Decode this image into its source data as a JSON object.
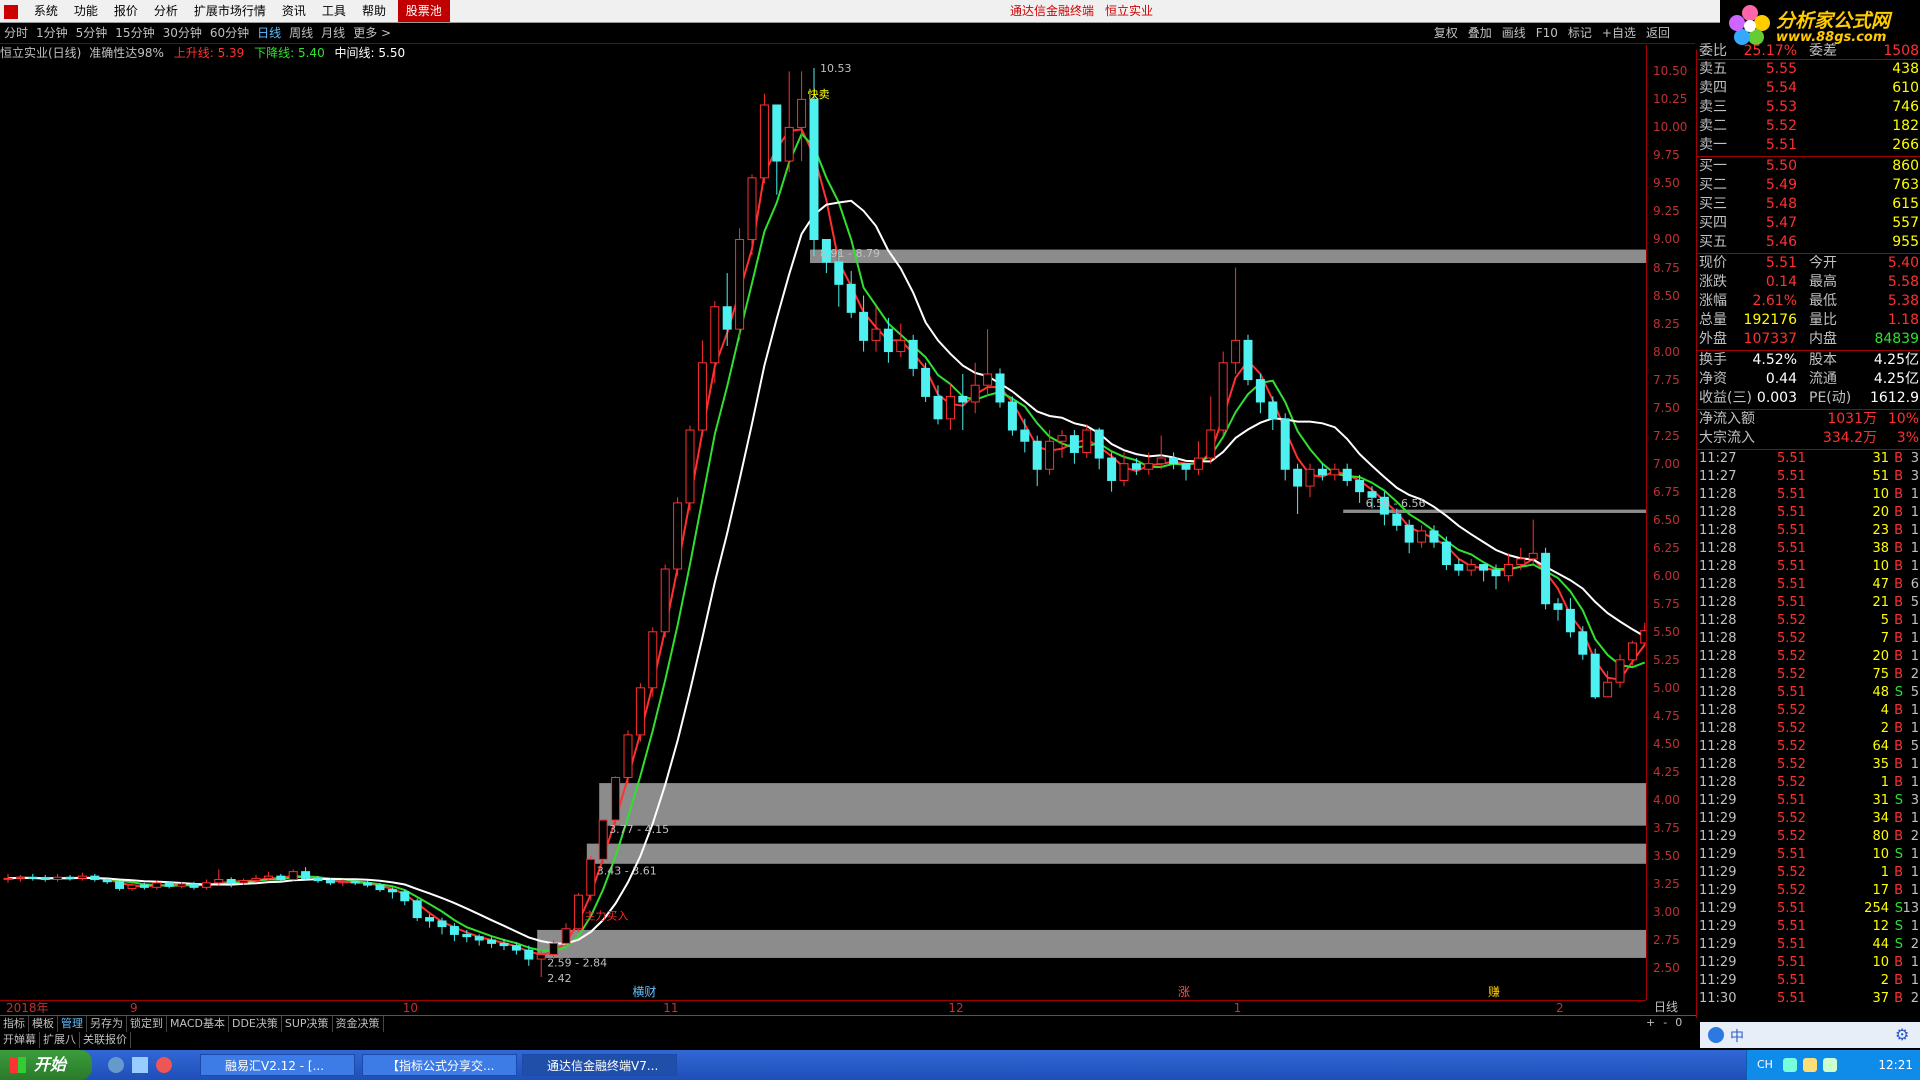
{
  "menubar": {
    "items": [
      "系统",
      "功能",
      "报价",
      "分析",
      "扩展市场行情",
      "资讯",
      "工具",
      "帮助"
    ],
    "hot_item": "股票池",
    "title": "通达信金融终端",
    "stock": "恒立实业"
  },
  "logo": {
    "line1": "分析家公式网",
    "line2": "www.88gs.com"
  },
  "periods": [
    "分时",
    "1分钟",
    "5分钟",
    "15分钟",
    "30分钟",
    "60分钟",
    "日线",
    "周线",
    "月线",
    "更多 >"
  ],
  "active_period": "日线",
  "right_tools": [
    "复权",
    "叠加",
    "画线",
    "F10",
    "标记",
    "+自选",
    "返回"
  ],
  "indicator": {
    "name": "恒立实业(日线)",
    "accuracy": "准确性达98%",
    "up_label": "上升线: 5.39",
    "down_label": "下降线: 5.40",
    "mid_label": "中间线: 5.50",
    "colors": {
      "up": "#ff3030",
      "down": "#30e030",
      "mid": "#ffffff"
    }
  },
  "chart_data": {
    "type": "candlestick",
    "y_ticks": [
      "10.50",
      "10.25",
      "10.00",
      "9.75",
      "9.50",
      "9.25",
      "9.00",
      "8.75",
      "8.50",
      "8.25",
      "8.00",
      "7.75",
      "7.50",
      "7.25",
      "7.00",
      "6.75",
      "6.50",
      "6.25",
      "6.00",
      "5.75",
      "5.50",
      "5.25",
      "5.00",
      "4.75",
      "4.50",
      "4.25",
      "4.00",
      "3.75",
      "3.50",
      "3.25",
      "3.00",
      "2.75",
      "2.50"
    ],
    "ylim": [
      2.42,
      10.53
    ],
    "x_labels": [
      {
        "text": "2018年",
        "idx": 0
      },
      {
        "text": "9",
        "idx": 10
      },
      {
        "text": "10",
        "idx": 32
      },
      {
        "text": "11",
        "idx": 53
      },
      {
        "text": "12",
        "idx": 76
      },
      {
        "text": "1",
        "idx": 99
      },
      {
        "text": "2",
        "idx": 125
      }
    ],
    "annotations": [
      {
        "text": "10.53",
        "idx": 65,
        "price": 10.53
      },
      {
        "text": "快卖",
        "idx": 64,
        "price": 10.3
      },
      {
        "text": "8.91 - 8.79",
        "idx": 65,
        "price": 8.88
      },
      {
        "text": "6.59 - 6.56",
        "idx": 109,
        "price": 6.65
      },
      {
        "text": "3.77 - 4.15",
        "idx": 48,
        "price": 3.74
      },
      {
        "text": "3.43 - 3.61",
        "idx": 47,
        "price": 3.37
      },
      {
        "text": "主力买入",
        "idx": 46,
        "price": 2.97
      },
      {
        "text": "2.59 - 2.84",
        "idx": 43,
        "price": 2.55
      },
      {
        "text": "2.42",
        "idx": 43,
        "price": 2.41
      }
    ],
    "zones": [
      {
        "low": 8.79,
        "high": 8.91,
        "from_idx": 65
      },
      {
        "low": 6.56,
        "high": 6.59,
        "from_idx": 108
      },
      {
        "low": 3.77,
        "high": 4.15,
        "from_idx": 48
      },
      {
        "low": 3.43,
        "high": 3.61,
        "from_idx": 47
      },
      {
        "low": 2.59,
        "high": 2.84,
        "from_idx": 43
      }
    ],
    "bottom_marks": [
      {
        "text": "横财",
        "idx": 51,
        "color": "#5fbfff"
      },
      {
        "text": "涨",
        "idx": 95,
        "color": "#ff5050"
      },
      {
        "text": "赚",
        "idx": 120,
        "color": "#ffcc00"
      }
    ],
    "candles": [
      [
        3.3,
        3.3,
        3.34,
        3.26
      ],
      [
        3.3,
        3.31,
        3.33,
        3.27
      ],
      [
        3.31,
        3.3,
        3.34,
        3.28
      ],
      [
        3.3,
        3.29,
        3.33,
        3.27
      ],
      [
        3.29,
        3.31,
        3.34,
        3.27
      ],
      [
        3.31,
        3.3,
        3.33,
        3.28
      ],
      [
        3.3,
        3.32,
        3.35,
        3.28
      ],
      [
        3.32,
        3.29,
        3.34,
        3.27
      ],
      [
        3.29,
        3.27,
        3.31,
        3.25
      ],
      [
        3.27,
        3.21,
        3.28,
        3.19
      ],
      [
        3.21,
        3.24,
        3.26,
        3.19
      ],
      [
        3.24,
        3.22,
        3.26,
        3.2
      ],
      [
        3.22,
        3.26,
        3.28,
        3.2
      ],
      [
        3.26,
        3.23,
        3.27,
        3.21
      ],
      [
        3.23,
        3.25,
        3.27,
        3.21
      ],
      [
        3.25,
        3.22,
        3.27,
        3.2
      ],
      [
        3.22,
        3.26,
        3.29,
        3.2
      ],
      [
        3.26,
        3.29,
        3.38,
        3.24
      ],
      [
        3.29,
        3.26,
        3.31,
        3.22
      ],
      [
        3.26,
        3.28,
        3.3,
        3.24
      ],
      [
        3.28,
        3.3,
        3.33,
        3.26
      ],
      [
        3.3,
        3.32,
        3.36,
        3.28
      ],
      [
        3.32,
        3.29,
        3.34,
        3.27
      ],
      [
        3.29,
        3.36,
        3.38,
        3.28
      ],
      [
        3.36,
        3.3,
        3.4,
        3.28
      ],
      [
        3.3,
        3.28,
        3.32,
        3.26
      ],
      [
        3.28,
        3.26,
        3.3,
        3.24
      ],
      [
        3.26,
        3.27,
        3.29,
        3.23
      ],
      [
        3.27,
        3.26,
        3.29,
        3.24
      ],
      [
        3.26,
        3.24,
        3.28,
        3.22
      ],
      [
        3.24,
        3.2,
        3.26,
        3.18
      ],
      [
        3.2,
        3.18,
        3.22,
        3.12
      ],
      [
        3.18,
        3.1,
        3.2,
        3.06
      ],
      [
        3.1,
        2.95,
        3.12,
        2.92
      ],
      [
        2.95,
        2.92,
        2.98,
        2.86
      ],
      [
        2.92,
        2.87,
        2.95,
        2.8
      ],
      [
        2.87,
        2.8,
        2.9,
        2.74
      ],
      [
        2.8,
        2.78,
        2.84,
        2.73
      ],
      [
        2.78,
        2.75,
        2.8,
        2.7
      ],
      [
        2.75,
        2.72,
        2.78,
        2.68
      ],
      [
        2.72,
        2.7,
        2.76,
        2.66
      ],
      [
        2.7,
        2.66,
        2.73,
        2.62
      ],
      [
        2.66,
        2.58,
        2.7,
        2.52
      ],
      [
        2.58,
        2.62,
        2.66,
        2.42
      ],
      [
        2.62,
        2.72,
        2.75,
        2.58
      ],
      [
        2.72,
        2.85,
        2.9,
        2.7
      ],
      [
        2.85,
        3.15,
        3.17,
        2.82
      ],
      [
        3.15,
        3.47,
        3.5,
        3.1
      ],
      [
        3.47,
        3.82,
        3.83,
        3.44
      ],
      [
        3.82,
        4.2,
        4.21,
        3.78
      ],
      [
        4.2,
        4.58,
        4.62,
        4.15
      ],
      [
        4.58,
        5.0,
        5.04,
        4.52
      ],
      [
        5.0,
        5.5,
        5.54,
        4.92
      ],
      [
        5.5,
        6.06,
        6.1,
        5.45
      ],
      [
        6.06,
        6.65,
        6.7,
        6.0
      ],
      [
        6.65,
        7.3,
        7.34,
        6.58
      ],
      [
        7.3,
        7.9,
        8.1,
        7.25
      ],
      [
        7.9,
        8.4,
        8.45,
        7.72
      ],
      [
        8.4,
        8.2,
        8.7,
        8.05
      ],
      [
        8.2,
        9.0,
        9.1,
        8.1
      ],
      [
        9.0,
        9.55,
        9.58,
        8.86
      ],
      [
        9.55,
        10.2,
        10.3,
        9.5
      ],
      [
        10.2,
        9.7,
        10.2,
        9.4
      ],
      [
        9.7,
        10.0,
        10.5,
        9.6
      ],
      [
        10.0,
        10.25,
        10.5,
        9.7
      ],
      [
        10.25,
        9.0,
        10.53,
        8.85
      ],
      [
        9.0,
        8.8,
        9.0,
        8.7
      ],
      [
        8.8,
        8.6,
        8.9,
        8.4
      ],
      [
        8.6,
        8.35,
        8.72,
        8.3
      ],
      [
        8.35,
        8.1,
        8.5,
        8.0
      ],
      [
        8.1,
        8.2,
        8.4,
        8.0
      ],
      [
        8.2,
        8.0,
        8.3,
        7.9
      ],
      [
        8.0,
        8.1,
        8.25,
        7.95
      ],
      [
        8.1,
        7.85,
        8.15,
        7.78
      ],
      [
        7.85,
        7.6,
        7.9,
        7.55
      ],
      [
        7.6,
        7.4,
        7.7,
        7.35
      ],
      [
        7.4,
        7.6,
        7.72,
        7.3
      ],
      [
        7.6,
        7.55,
        7.8,
        7.3
      ],
      [
        7.55,
        7.7,
        7.9,
        7.45
      ],
      [
        7.7,
        7.8,
        8.2,
        7.6
      ],
      [
        7.8,
        7.55,
        7.85,
        7.5
      ],
      [
        7.55,
        7.3,
        7.6,
        7.25
      ],
      [
        7.3,
        7.2,
        7.4,
        7.1
      ],
      [
        7.2,
        6.95,
        7.25,
        6.8
      ],
      [
        6.95,
        7.2,
        7.3,
        6.9
      ],
      [
        7.2,
        7.25,
        7.3,
        7.05
      ],
      [
        7.25,
        7.1,
        7.3,
        7.0
      ],
      [
        7.1,
        7.3,
        7.35,
        7.05
      ],
      [
        7.3,
        7.05,
        7.32,
        6.95
      ],
      [
        7.05,
        6.85,
        7.1,
        6.75
      ],
      [
        6.85,
        7.0,
        7.1,
        6.8
      ],
      [
        7.0,
        6.95,
        7.05,
        6.9
      ],
      [
        6.95,
        7.0,
        7.1,
        6.9
      ],
      [
        7.0,
        7.05,
        7.25,
        6.95
      ],
      [
        7.05,
        7.0,
        7.1,
        6.95
      ],
      [
        7.0,
        6.95,
        7.0,
        6.85
      ],
      [
        6.95,
        7.05,
        7.2,
        6.9
      ],
      [
        7.05,
        7.3,
        7.6,
        7.0
      ],
      [
        7.3,
        7.9,
        8.0,
        7.25
      ],
      [
        7.9,
        8.1,
        8.75,
        7.8
      ],
      [
        8.1,
        7.75,
        8.15,
        7.7
      ],
      [
        7.75,
        7.55,
        7.8,
        7.45
      ],
      [
        7.55,
        7.4,
        7.6,
        7.3
      ],
      [
        7.4,
        6.95,
        7.45,
        6.85
      ],
      [
        6.95,
        6.8,
        7.0,
        6.55
      ],
      [
        6.8,
        6.95,
        7.0,
        6.7
      ],
      [
        6.95,
        6.9,
        7.0,
        6.85
      ],
      [
        6.9,
        6.95,
        7.0,
        6.85
      ],
      [
        6.95,
        6.85,
        7.0,
        6.8
      ],
      [
        6.85,
        6.75,
        6.9,
        6.65
      ],
      [
        6.75,
        6.7,
        6.8,
        6.6
      ],
      [
        6.7,
        6.55,
        6.75,
        6.45
      ],
      [
        6.55,
        6.45,
        6.6,
        6.4
      ],
      [
        6.45,
        6.3,
        6.5,
        6.2
      ],
      [
        6.3,
        6.4,
        6.45,
        6.25
      ],
      [
        6.4,
        6.3,
        6.45,
        6.25
      ],
      [
        6.3,
        6.1,
        6.35,
        6.05
      ],
      [
        6.1,
        6.05,
        6.15,
        6.0
      ],
      [
        6.05,
        6.1,
        6.15,
        6.0
      ],
      [
        6.1,
        6.05,
        6.1,
        5.95
      ],
      [
        6.05,
        6.0,
        6.1,
        5.88
      ],
      [
        6.0,
        6.1,
        6.2,
        5.95
      ],
      [
        6.1,
        6.15,
        6.25,
        6.05
      ],
      [
        6.15,
        6.2,
        6.5,
        6.1
      ],
      [
        6.2,
        5.75,
        6.25,
        5.7
      ],
      [
        5.75,
        5.7,
        5.8,
        5.6
      ],
      [
        5.7,
        5.5,
        5.8,
        5.45
      ],
      [
        5.5,
        5.3,
        5.55,
        5.25
      ],
      [
        5.3,
        4.92,
        5.35,
        4.9
      ],
      [
        4.92,
        5.05,
        5.15,
        4.95
      ],
      [
        5.05,
        5.25,
        5.3,
        5.0
      ],
      [
        5.25,
        5.4,
        5.42,
        5.2
      ],
      [
        5.4,
        5.51,
        5.58,
        5.38
      ]
    ],
    "series": [
      {
        "name": "上升线",
        "window": 3,
        "color": "#ff3030"
      },
      {
        "name": "下降线",
        "window": 5,
        "color": "#30e030"
      },
      {
        "name": "中间线",
        "window": 10,
        "color": "#ffffff"
      }
    ]
  },
  "right_label": "日线",
  "scroll_btns": [
    "+",
    "-",
    "0"
  ],
  "bottom_tabs1": [
    "指标",
    "模板",
    "管理",
    "另存为",
    "锁定到",
    "MACD基本",
    "DDE决策",
    "SUP决策",
    "资金决策"
  ],
  "bottom_tabs1_active": "管理",
  "bottom_tabs2": [
    "开婵幕",
    "扩展八",
    "关联报价"
  ],
  "quote": {
    "top": {
      "label": "委比",
      "v1": "25.17%",
      "label2": "委差",
      "v2": "1508"
    },
    "asks": [
      {
        "label": "卖五",
        "price": "5.55",
        "vol": "438"
      },
      {
        "label": "卖四",
        "price": "5.54",
        "vol": "610"
      },
      {
        "label": "卖三",
        "price": "5.53",
        "vol": "746"
      },
      {
        "label": "卖二",
        "price": "5.52",
        "vol": "182"
      },
      {
        "label": "卖一",
        "price": "5.51",
        "vol": "266"
      }
    ],
    "bids": [
      {
        "label": "买一",
        "price": "5.50",
        "vol": "860"
      },
      {
        "label": "买二",
        "price": "5.49",
        "vol": "763"
      },
      {
        "label": "买三",
        "price": "5.48",
        "vol": "615"
      },
      {
        "label": "买四",
        "price": "5.47",
        "vol": "557"
      },
      {
        "label": "买五",
        "price": "5.46",
        "vol": "955"
      }
    ],
    "stats": [
      {
        "l1": "现价",
        "v1": "5.51",
        "l2": "今开",
        "v2": "5.40",
        "c1": "#ff3030",
        "c2": "#ff3030"
      },
      {
        "l1": "涨跌",
        "v1": "0.14",
        "l2": "最高",
        "v2": "5.58",
        "c1": "#ff3030",
        "c2": "#ff3030"
      },
      {
        "l1": "涨幅",
        "v1": "2.61%",
        "l2": "最低",
        "v2": "5.38",
        "c1": "#ff3030",
        "c2": "#ff3030"
      },
      {
        "l1": "总量",
        "v1": "192176",
        "l2": "量比",
        "v2": "1.18",
        "c1": "#ffff00",
        "c2": "#ff3030"
      },
      {
        "l1": "外盘",
        "v1": "107337",
        "l2": "内盘",
        "v2": "84839",
        "c1": "#ff3030",
        "c2": "#30e030"
      }
    ],
    "stats2": [
      {
        "l1": "换手",
        "v1": "4.52%",
        "l2": "股本",
        "v2": "4.25亿",
        "c1": "#ffffff",
        "c2": "#ffffff"
      },
      {
        "l1": "净资",
        "v1": "0.44",
        "l2": "流通",
        "v2": "4.25亿",
        "c1": "#ffffff",
        "c2": "#ffffff"
      },
      {
        "l1": "收益(三)",
        "v1": "0.003",
        "l2": "PE(动)",
        "v2": "1612.9",
        "c1": "#ffffff",
        "c2": "#ffffff"
      }
    ],
    "flows": [
      {
        "label": "净流入额",
        "v1": "1031万",
        "v2": "10%"
      },
      {
        "label": "大宗流入",
        "v1": "334.2万",
        "v2": "3%"
      }
    ]
  },
  "ticks": [
    [
      "11:27",
      "5.51",
      "31",
      "B",
      "3"
    ],
    [
      "11:27",
      "5.51",
      "51",
      "B",
      "3"
    ],
    [
      "11:28",
      "5.51",
      "10",
      "B",
      "1"
    ],
    [
      "11:28",
      "5.51",
      "20",
      "B",
      "1"
    ],
    [
      "11:28",
      "5.51",
      "23",
      "B",
      "1"
    ],
    [
      "11:28",
      "5.51",
      "38",
      "B",
      "1"
    ],
    [
      "11:28",
      "5.51",
      "10",
      "B",
      "1"
    ],
    [
      "11:28",
      "5.51",
      "47",
      "B",
      "6"
    ],
    [
      "11:28",
      "5.51",
      "21",
      "B",
      "5"
    ],
    [
      "11:28",
      "5.52",
      "5",
      "B",
      "1"
    ],
    [
      "11:28",
      "5.52",
      "7",
      "B",
      "1"
    ],
    [
      "11:28",
      "5.52",
      "20",
      "B",
      "1"
    ],
    [
      "11:28",
      "5.52",
      "75",
      "B",
      "2"
    ],
    [
      "11:28",
      "5.51",
      "48",
      "S",
      "5"
    ],
    [
      "11:28",
      "5.52",
      "4",
      "B",
      "1"
    ],
    [
      "11:28",
      "5.52",
      "2",
      "B",
      "1"
    ],
    [
      "11:28",
      "5.52",
      "64",
      "B",
      "5"
    ],
    [
      "11:28",
      "5.52",
      "35",
      "B",
      "1"
    ],
    [
      "11:28",
      "5.52",
      "1",
      "B",
      "1"
    ],
    [
      "11:29",
      "5.51",
      "31",
      "S",
      "3"
    ],
    [
      "11:29",
      "5.52",
      "34",
      "B",
      "1"
    ],
    [
      "11:29",
      "5.52",
      "80",
      "B",
      "2"
    ],
    [
      "11:29",
      "5.51",
      "10",
      "S",
      "1"
    ],
    [
      "11:29",
      "5.52",
      "1",
      "B",
      "1"
    ],
    [
      "11:29",
      "5.52",
      "17",
      "B",
      "1"
    ],
    [
      "11:29",
      "5.51",
      "254",
      "S",
      "13"
    ],
    [
      "11:29",
      "5.51",
      "12",
      "S",
      "1"
    ],
    [
      "11:29",
      "5.51",
      "44",
      "S",
      "2"
    ],
    [
      "11:29",
      "5.51",
      "10",
      "B",
      "1"
    ],
    [
      "11:29",
      "5.51",
      "2",
      "B",
      "1"
    ],
    [
      "11:30",
      "5.51",
      "37",
      "B",
      "2"
    ]
  ],
  "taskbar": {
    "start": "开始",
    "tasks": [
      "融易汇V2.12 - [...",
      "【指标公式分享交...",
      "通达信金融终端V7..."
    ],
    "lang": "CH",
    "clock": "12:21"
  }
}
